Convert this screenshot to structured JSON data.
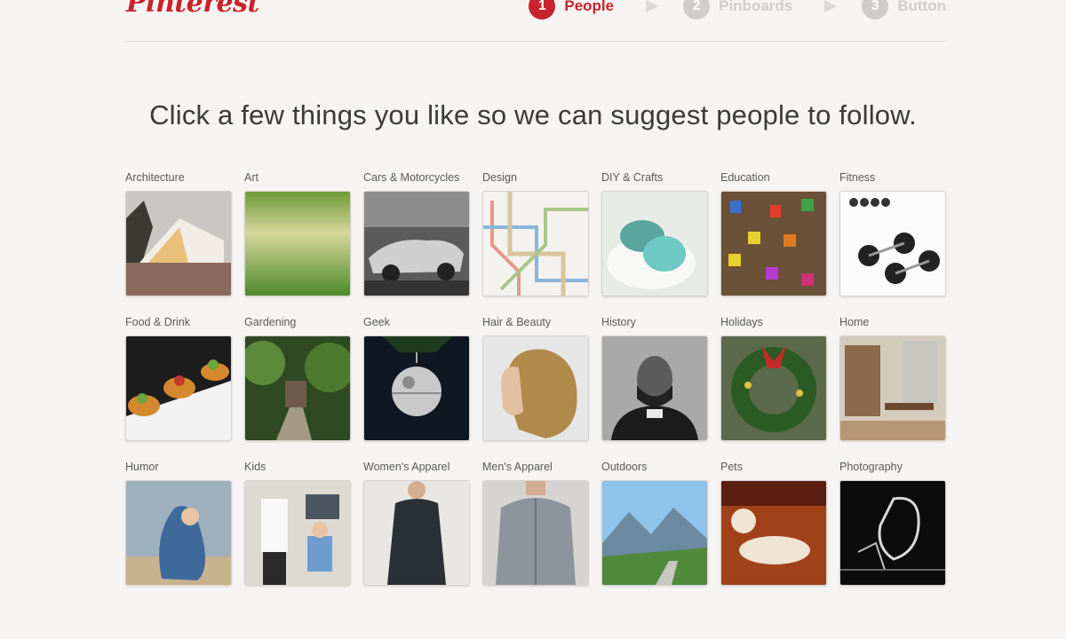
{
  "brand": {
    "logo_text": "Pinterest",
    "accent_color": "#c8232c"
  },
  "steps": [
    {
      "number": "1",
      "label": "People",
      "active": true
    },
    {
      "number": "2",
      "label": "Pinboards",
      "active": false
    },
    {
      "number": "3",
      "label": "Button",
      "active": false
    }
  ],
  "headline": "Click a few things you like so we can suggest people to follow.",
  "categories": [
    {
      "label": "Architecture"
    },
    {
      "label": "Art"
    },
    {
      "label": "Cars & Motorcycles"
    },
    {
      "label": "Design"
    },
    {
      "label": "DIY & Crafts"
    },
    {
      "label": "Education"
    },
    {
      "label": "Fitness"
    },
    {
      "label": "Food & Drink"
    },
    {
      "label": "Gardening"
    },
    {
      "label": "Geek"
    },
    {
      "label": "Hair & Beauty"
    },
    {
      "label": "History"
    },
    {
      "label": "Holidays"
    },
    {
      "label": "Home"
    },
    {
      "label": "Humor"
    },
    {
      "label": "Kids"
    },
    {
      "label": "Women's Apparel"
    },
    {
      "label": "Men's Apparel"
    },
    {
      "label": "Outdoors"
    },
    {
      "label": "Pets"
    },
    {
      "label": "Photography"
    }
  ]
}
